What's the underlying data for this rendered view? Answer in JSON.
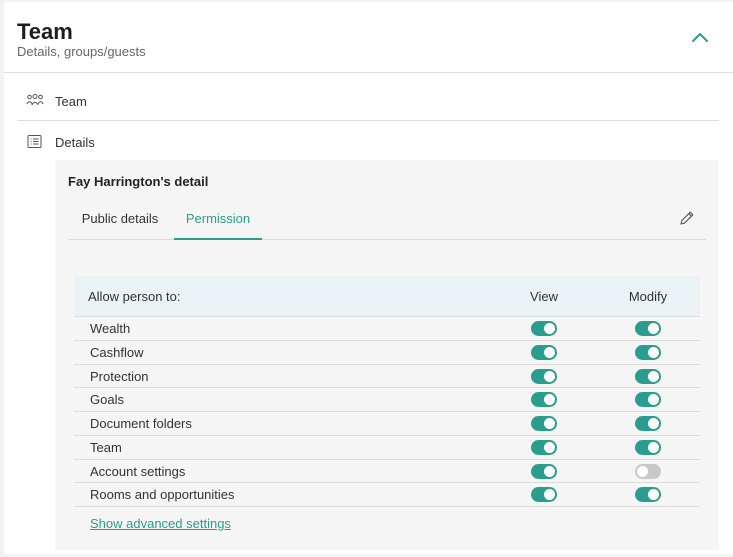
{
  "header": {
    "title": "Team",
    "subtitle": "Details, groups/guests"
  },
  "nav": {
    "team_label": "Team",
    "details_label": "Details"
  },
  "detail": {
    "title": "Fay Harrington's detail",
    "tabs": [
      {
        "label": "Public details"
      },
      {
        "label": "Permission"
      }
    ],
    "active_tab": "Permission"
  },
  "permissions": {
    "header": {
      "label": "Allow person to:",
      "view": "View",
      "modify": "Modify"
    },
    "rows": [
      {
        "label": "Wealth",
        "view": true,
        "modify": true
      },
      {
        "label": "Cashflow",
        "view": true,
        "modify": true
      },
      {
        "label": "Protection",
        "view": true,
        "modify": true
      },
      {
        "label": "Goals",
        "view": true,
        "modify": true
      },
      {
        "label": "Document folders",
        "view": true,
        "modify": true
      },
      {
        "label": "Team",
        "view": true,
        "modify": true
      },
      {
        "label": "Account settings",
        "view": true,
        "modify": false
      },
      {
        "label": "Rooms and opportunities",
        "view": true,
        "modify": true
      }
    ],
    "advanced_link": "Show advanced settings"
  },
  "colors": {
    "accent": "#2a9d8f",
    "toggle_off": "#c8c8c8",
    "table_header_bg": "#eaf2f5"
  }
}
